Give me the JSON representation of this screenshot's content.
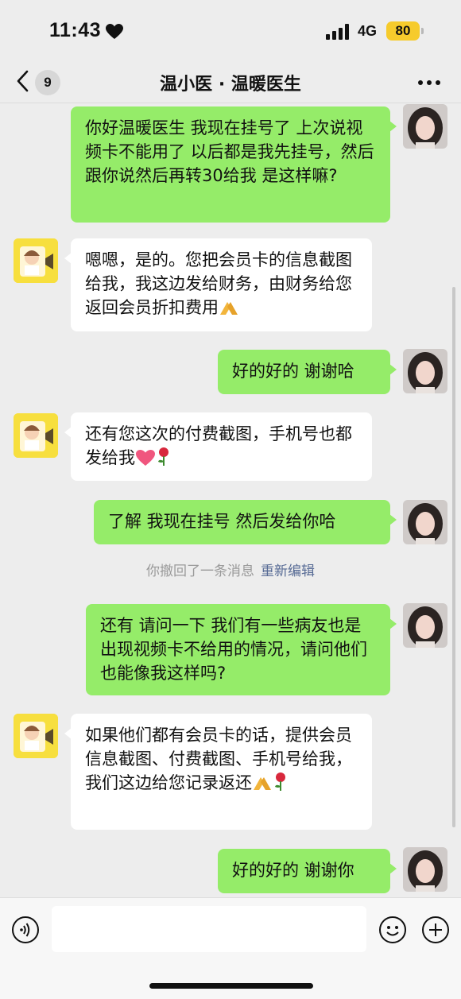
{
  "status_bar": {
    "time": "11:43",
    "network": "4G",
    "battery": "80"
  },
  "header": {
    "unread_count": "9",
    "title": "温小医 · 温暖医生"
  },
  "messages": [
    {
      "from": "me",
      "text": "你好温暖医生  我现在挂号了   上次说视频卡不能用了    以后都是我先挂号，然后跟你说然后再转30给我 是这样嘛?"
    },
    {
      "from": "doctor",
      "text": "嗯嗯，是的。您把会员卡的信息截图给我，我这边发给财务，由财务给您返回会员折扣费用"
    },
    {
      "from": "me",
      "text": "好的好的 谢谢哈"
    },
    {
      "from": "doctor",
      "text": "还有您这次的付费截图，手机号也都发给我"
    },
    {
      "from": "me",
      "text": "了解 我现在挂号  然后发给你哈"
    },
    {
      "from": "me",
      "text": "还有 请问一下  我们有一些病友也是出现视频卡不给用的情况，请问他们也能像我这样吗?"
    },
    {
      "from": "doctor",
      "text": "如果他们都有会员卡的话，提供会员信息截图、付费截图、手机号给我，我们这边给您记录返还"
    },
    {
      "from": "me",
      "text": "好的好的  谢谢你"
    }
  ],
  "system_notice": {
    "text": "你撤回了一条消息",
    "action": "重新编辑"
  },
  "input": {
    "placeholder": ""
  },
  "icons": {
    "heart": "heart-icon",
    "back": "chevron-left-icon",
    "more": "more-icon",
    "voice": "voice-icon",
    "emoji": "emoji-icon",
    "plus": "plus-icon",
    "folded_hands": "folded-hands-emoji",
    "rose": "rose-emoji",
    "pink_heart": "pink-heart-emoji"
  },
  "colors": {
    "my_bubble": "#95ec69",
    "their_bubble": "#ffffff",
    "background": "#ededed",
    "link": "#576b95"
  }
}
